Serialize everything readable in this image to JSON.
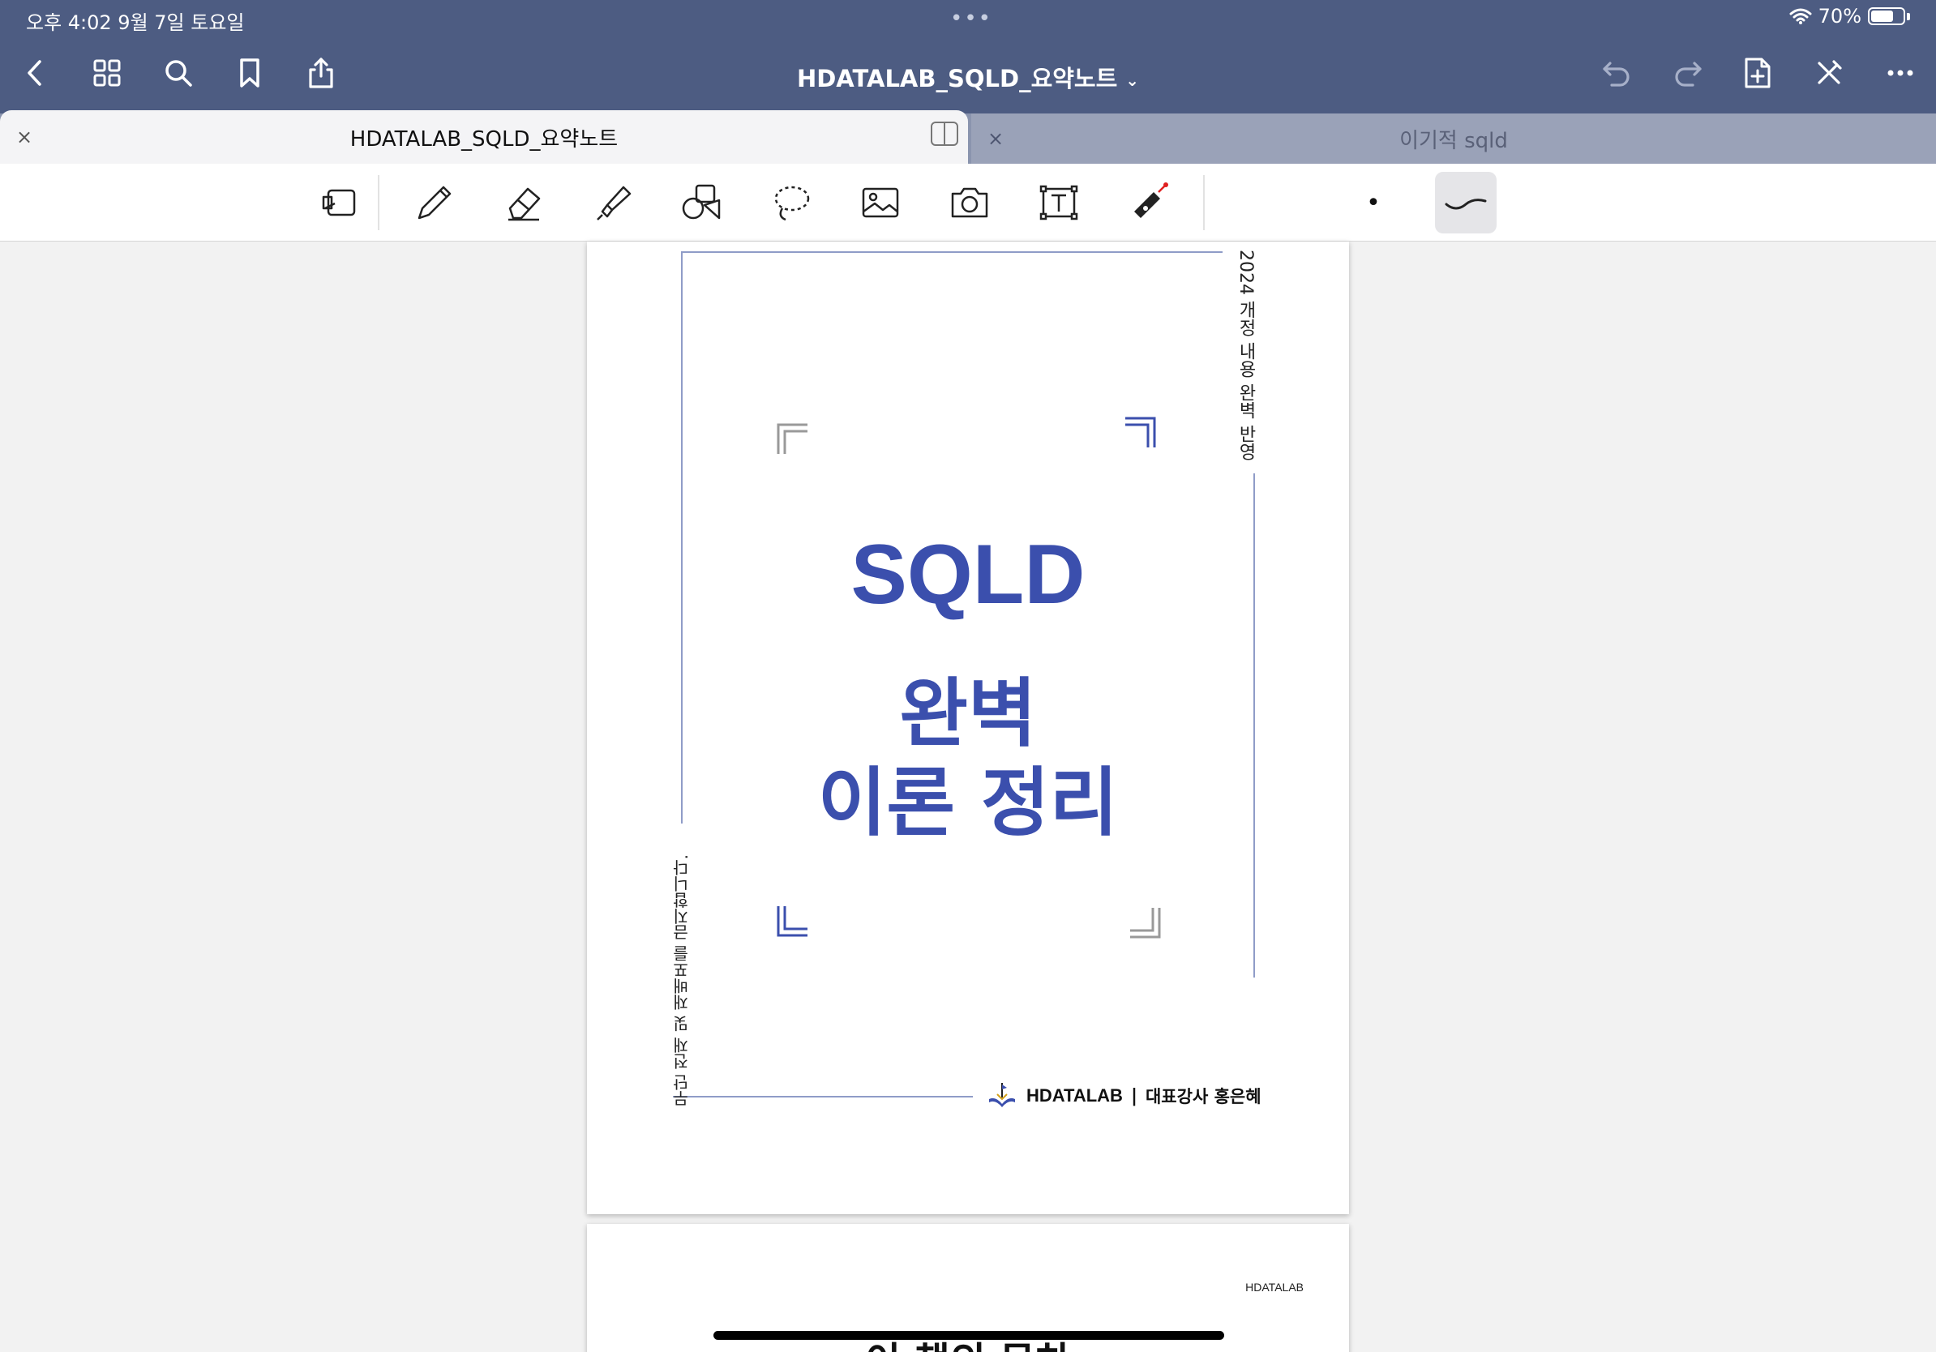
{
  "status_bar": {
    "time_date": "오후 4:02   9월 7일 토요일",
    "dots": "•••",
    "wifi_icon": "wifi-icon",
    "battery_percent": "70%",
    "battery_level": 0.7
  },
  "nav": {
    "title": "HDATALAB_SQLD_요약노트",
    "title_chevron": "⌄",
    "icons": [
      "back-icon",
      "grid-icon",
      "search-icon",
      "bookmark-icon",
      "share-icon",
      "undo-icon",
      "redo-icon",
      "add-page-icon",
      "pencil-off-icon",
      "more-icon"
    ]
  },
  "tabs": [
    {
      "label": "HDATALAB_SQLD_요약노트",
      "close": "×",
      "active": true
    },
    {
      "label": "이기적 sqld",
      "close": "×",
      "active": false
    }
  ],
  "toolbar": {
    "tools": [
      "reading-mode-icon",
      "pen-icon",
      "eraser-icon",
      "highlighter-icon",
      "shapes-icon",
      "lasso-icon",
      "image-icon",
      "camera-icon",
      "text-icon",
      "laser-pointer-icon"
    ],
    "stroke_width_dot": "•"
  },
  "page1": {
    "vertical_top_right": "2024 개정 내용 완벽 반영",
    "vertical_left": "무단 전재 및 재배포를 금지합니다.",
    "title": "SQLD",
    "subtitle_line1": "완벽",
    "subtitle_line2": "이론 정리",
    "brand": "HDATALAB",
    "separator": "|",
    "author": "대표강사 홍은혜",
    "accent_color": "#3b4fad"
  },
  "page2": {
    "header": "HDATALAB",
    "title": "이 책의 목차"
  }
}
